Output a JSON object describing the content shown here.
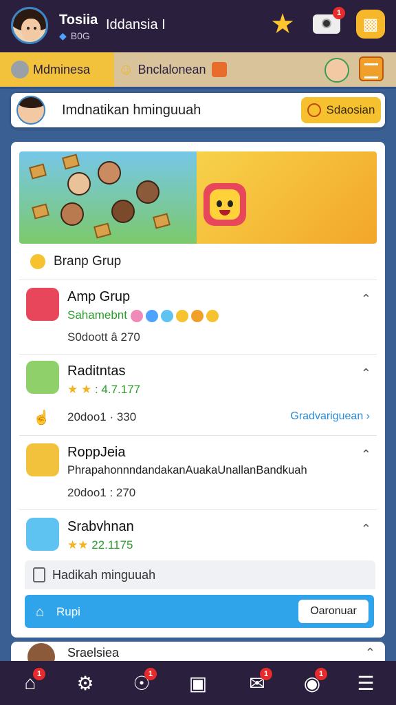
{
  "header": {
    "name": "Tosiia",
    "country": "Iddansia I",
    "sub_icon": "gem-icon",
    "sub_text": "B0G",
    "camera_badge": "1"
  },
  "nav": {
    "tab1_label": "Mdminesa",
    "tab2_label": "Bnclalonean"
  },
  "search": {
    "input_text": "Imdnatikan hminguuah",
    "button_label": "Sdaosian"
  },
  "group": {
    "header_label": "Branp Grup"
  },
  "items": [
    {
      "title": "Amp Grup",
      "subtitle": "Sahamebnt",
      "meta": "S0doott â 270"
    },
    {
      "title": "Raditntas",
      "stars": "★ ★",
      "rating": ": 4.7.177",
      "meta": "20doo1 · 330",
      "link": "Gradvariguean"
    },
    {
      "title": "RoppJeia",
      "desc": "PhrapahonnndandakanAuakaUnallanBandkuah",
      "meta": "20doo1 : 270"
    },
    {
      "title": "Srabvhnan",
      "stars": "★★",
      "rating": "22.1175"
    }
  ],
  "footer": {
    "row_label": "Hadikah minguuah",
    "bar_label": "Rupi",
    "bar_button": "Oaronuar"
  },
  "peek": {
    "label": "Sraelsiea"
  },
  "bottom_nav": {
    "badges": [
      "1",
      "1",
      "1",
      "1"
    ]
  },
  "colors": {
    "topbar": "#2a1f3d",
    "accent_yellow": "#f5c12f",
    "accent_blue": "#2fa4ea",
    "background": "#3a5f93"
  }
}
